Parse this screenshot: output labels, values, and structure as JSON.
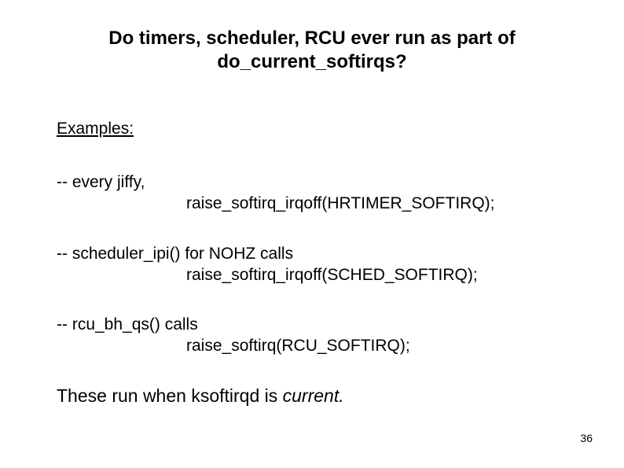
{
  "title_line1": "Do timers, scheduler, RCU ever run as part of",
  "title_line2": "do_current_softirqs?",
  "examples_heading": "Examples:",
  "items": [
    {
      "lead": "-- every jiffy,",
      "call": "raise_softirq_irqoff(HRTIMER_SOFTIRQ);"
    },
    {
      "lead": "-- scheduler_ipi() for NOHZ calls",
      "call": "raise_softirq_irqoff(SCHED_SOFTIRQ);"
    },
    {
      "lead": "-- rcu_bh_qs() calls",
      "call": "raise_softirq(RCU_SOFTIRQ);"
    }
  ],
  "closing_prefix": "These run when ksoftirqd is ",
  "closing_italic": "current.",
  "page_number": "36"
}
